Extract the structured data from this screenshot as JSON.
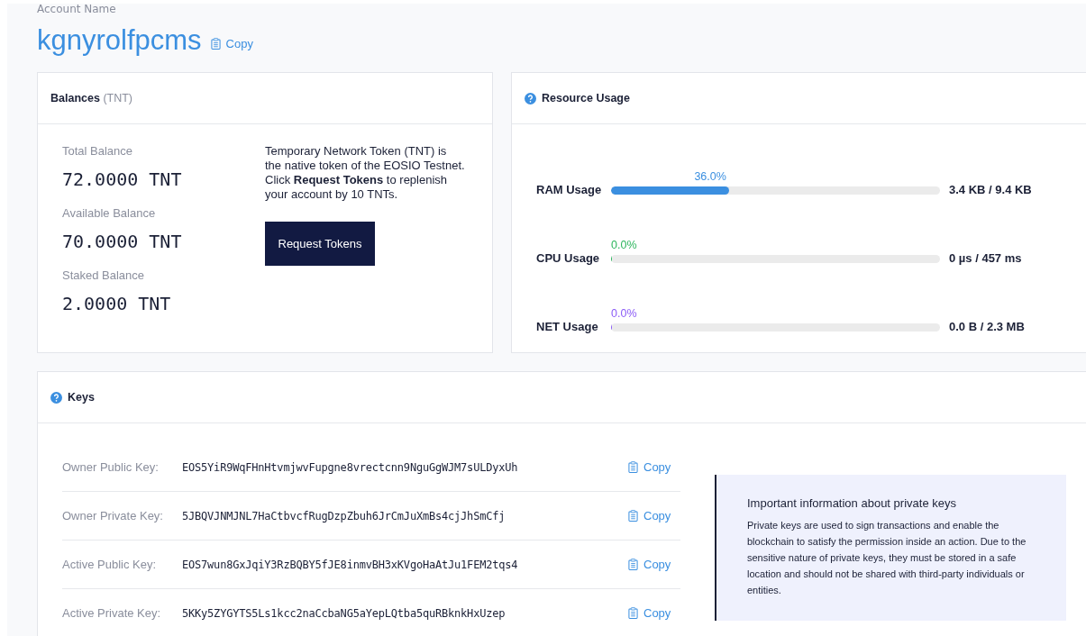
{
  "account": {
    "label": "Account Name",
    "name": "kgnyrolfpcms",
    "copy": "Copy"
  },
  "balances": {
    "title": "Balances",
    "unit": "(TNT)",
    "items": [
      {
        "label": "Total Balance",
        "value": "72.0000 TNT"
      },
      {
        "label": "Available Balance",
        "value": "70.0000 TNT"
      },
      {
        "label": "Staked Balance",
        "value": "2.0000 TNT"
      }
    ],
    "info": "Temporary Network Token (TNT) is the native token of the EOSIO Testnet. Click **Request Tokens** to replenish your account by 10 TNTs.",
    "button": "Request Tokens"
  },
  "resources": {
    "title": "Resource Usage",
    "items": [
      {
        "label": "RAM Usage",
        "percent": "36.0%",
        "level": 0.36,
        "color": "#3b8fe0",
        "reading": "3.4 KB / 9.4 KB"
      },
      {
        "label": "CPU Usage",
        "percent": "0.0%",
        "level": 0,
        "color": "#2db55d",
        "reading": "0 µs / 457 ms"
      },
      {
        "label": "NET Usage",
        "percent": "0.0%",
        "level": 0,
        "color": "#8b5cf6",
        "reading": "0.0 B / 2.3 MB"
      }
    ]
  },
  "keys": {
    "title": "Keys",
    "rows": [
      {
        "label": "Owner Public Key:",
        "value": "EOS5YiR9WqFHnHtvmjwvFupgne8vrectcnn9NguGgWJM7sULDyxUh",
        "copy": "Copy"
      },
      {
        "label": "Owner Private Key:",
        "value": "5JBQVJNMJNL7HaCtbvcfRugDzpZbuh6JrCmJuXmBs4cjJhSmCfj",
        "copy": "Copy"
      },
      {
        "label": "Active Public Key:",
        "value": "EOS7wun8GxJqiY3RzBQBY5fJE8inmvBH3xKVgoHaAtJu1FEM2tqs4",
        "copy": "Copy"
      },
      {
        "label": "Active Private Key:",
        "value": "5KKy5ZYGYTS5Ls1kcc2naCcbaNG5aYepLQtba5quRBknkHxUzep",
        "copy": "Copy"
      }
    ],
    "notice": {
      "title": "Important information about private keys",
      "text": "Private keys are used to sign transactions and enable the blockchain to satisfy the permission inside an action. Due to the sensitive nature of private keys, they must be stored in a safe location and should not be shared with third-party individuals or entities."
    }
  }
}
